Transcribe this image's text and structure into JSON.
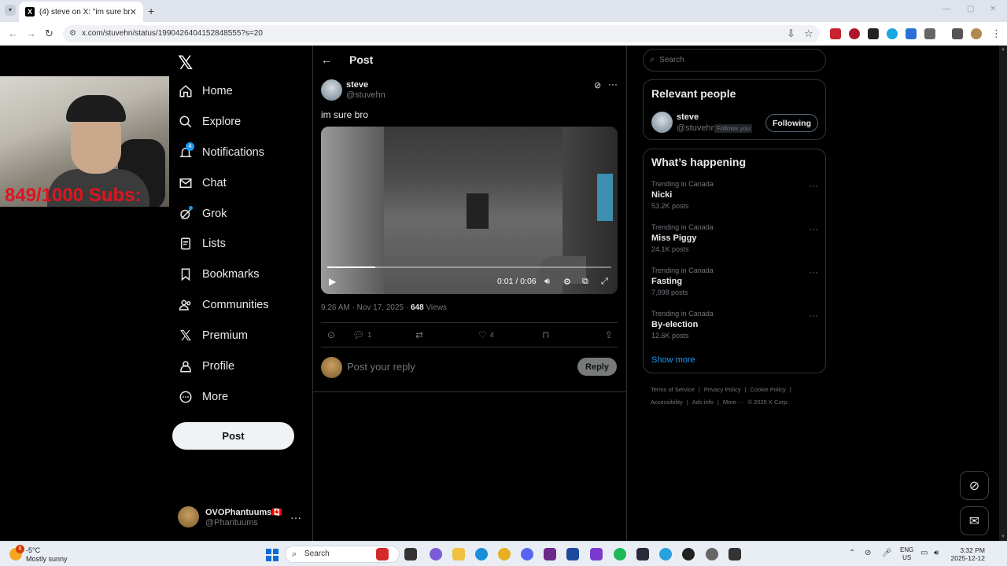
{
  "browser": {
    "tab_title": "(4) steve on X: \"im sure bro htt",
    "url": "x.com/stuvehn/status/1990426404152848555?s=20"
  },
  "overlay": {
    "subs_text": "849/1000  Subs:"
  },
  "sidebar": {
    "items": [
      {
        "label": "Home",
        "icon": "home-icon"
      },
      {
        "label": "Explore",
        "icon": "search-icon"
      },
      {
        "label": "Notifications",
        "icon": "bell-icon",
        "badge": "4"
      },
      {
        "label": "Chat",
        "icon": "mail-icon"
      },
      {
        "label": "Grok",
        "icon": "grok-icon"
      },
      {
        "label": "Lists",
        "icon": "list-icon"
      },
      {
        "label": "Bookmarks",
        "icon": "bookmark-icon"
      },
      {
        "label": "Communities",
        "icon": "people-icon"
      },
      {
        "label": "Premium",
        "icon": "x-icon"
      },
      {
        "label": "Profile",
        "icon": "person-icon"
      },
      {
        "label": "More",
        "icon": "more-circle-icon"
      }
    ],
    "post_button": "Post",
    "account": {
      "name": "OVOPhantuums🇨🇦",
      "handle": "@Phantuums"
    }
  },
  "main": {
    "header_title": "Post",
    "author": {
      "name": "steve",
      "handle": "@stuvehn"
    },
    "text": "im sure bro",
    "video": {
      "current": "0:01",
      "duration": "0:06",
      "progress_fraction": 0.17
    },
    "timestamp": "9:26 AM · Nov 17, 2025 · ",
    "views_count": "648",
    "views_label": " Views",
    "actions": {
      "replies": "1",
      "likes": "4"
    },
    "reply_placeholder": "Post your reply",
    "reply_button": "Reply"
  },
  "right": {
    "search_placeholder": "Search",
    "relevant_title": "Relevant people",
    "relevant_person": {
      "name": "steve",
      "handle": "@stuvehn",
      "follows_you": "Follows you",
      "button": "Following"
    },
    "happening_title": "What’s happening",
    "trends": [
      {
        "context": "Trending in Canada",
        "name": "Nicki",
        "count": "53.2K posts"
      },
      {
        "context": "Trending in Canada",
        "name": "Miss Piggy",
        "count": "24.1K posts"
      },
      {
        "context": "Trending in Canada",
        "name": "Fasting",
        "count": "7,098 posts"
      },
      {
        "context": "Trending in Canada",
        "name": "By-election",
        "count": "12.6K posts"
      }
    ],
    "show_more": "Show more",
    "footer": [
      "Terms of Service",
      "|",
      "Privacy Policy",
      "|",
      "Cookie Policy",
      "|",
      "Accessibility",
      "|",
      "Ads info",
      "|",
      "More ···",
      "© 2025 X Corp."
    ]
  },
  "taskbar": {
    "temp": "-5°C",
    "condition": "Mostly sunny",
    "weather_badge": "6",
    "search": "Search",
    "lang1": "ENG",
    "lang2": "US",
    "time": "3:32 PM",
    "date": "2025-12-12"
  }
}
